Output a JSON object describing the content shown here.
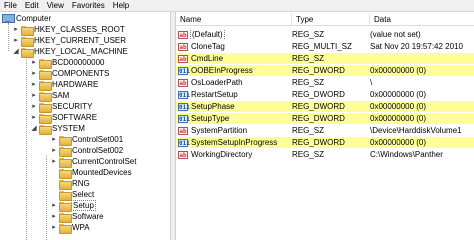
{
  "menu": [
    "File",
    "Edit",
    "View",
    "Favorites",
    "Help"
  ],
  "tree": {
    "root_label": "Computer",
    "items": [
      {
        "label": "HKEY_CLASSES_ROOT",
        "expander": "▸"
      },
      {
        "label": "HKEY_CURRENT_USER",
        "expander": "▸"
      },
      {
        "label": "HKEY_LOCAL_MACHINE",
        "expander": "◢"
      },
      {
        "label": "BCD00000000",
        "expander": "▸"
      },
      {
        "label": "COMPONENTS",
        "expander": "▸"
      },
      {
        "label": "HARDWARE",
        "expander": "▸"
      },
      {
        "label": "SAM",
        "expander": "▸"
      },
      {
        "label": "SECURITY",
        "expander": "▸"
      },
      {
        "label": "SOFTWARE",
        "expander": "▸"
      },
      {
        "label": "SYSTEM",
        "expander": "◢"
      },
      {
        "label": "ControlSet001",
        "expander": "▸"
      },
      {
        "label": "ControlSet002",
        "expander": "▸"
      },
      {
        "label": "CurrentControlSet",
        "expander": "▸"
      },
      {
        "label": "MountedDevices",
        "expander": ""
      },
      {
        "label": "RNG",
        "expander": ""
      },
      {
        "label": "Select",
        "expander": ""
      },
      {
        "label": "Setup",
        "expander": "▸"
      },
      {
        "label": "Software",
        "expander": "▸"
      },
      {
        "label": "WPA",
        "expander": "▸"
      }
    ]
  },
  "columns": {
    "name": "Name",
    "type": "Type",
    "data": "Data"
  },
  "values": [
    {
      "name": "(Default)",
      "type": "REG_SZ",
      "data": "(value not set)",
      "kind": "sz",
      "highlight": false
    },
    {
      "name": "CloneTag",
      "type": "REG_MULTI_SZ",
      "data": "Sat Nov 20 19:57:42 2010",
      "kind": "sz",
      "highlight": false
    },
    {
      "name": "CmdLine",
      "type": "REG_SZ",
      "data": "",
      "kind": "sz",
      "highlight": true
    },
    {
      "name": "OOBEInProgress",
      "type": "REG_DWORD",
      "data": "0x00000000 (0)",
      "kind": "dw",
      "highlight": true
    },
    {
      "name": "OsLoaderPath",
      "type": "REG_SZ",
      "data": "\\",
      "kind": "sz",
      "highlight": false
    },
    {
      "name": "RestartSetup",
      "type": "REG_DWORD",
      "data": "0x00000000 (0)",
      "kind": "dw",
      "highlight": false
    },
    {
      "name": "SetupPhase",
      "type": "REG_DWORD",
      "data": "0x00000000 (0)",
      "kind": "dw",
      "highlight": true
    },
    {
      "name": "SetupType",
      "type": "REG_DWORD",
      "data": "0x00000000 (0)",
      "kind": "dw",
      "highlight": true
    },
    {
      "name": "SystemPartition",
      "type": "REG_SZ",
      "data": "\\Device\\HarddiskVolume1",
      "kind": "sz",
      "highlight": false
    },
    {
      "name": "SystemSetupInProgress",
      "type": "REG_DWORD",
      "data": "0x00000000 (0)",
      "kind": "dw",
      "highlight": true
    },
    {
      "name": "WorkingDirectory",
      "type": "REG_SZ",
      "data": "C:\\Windows\\Panther",
      "kind": "sz",
      "highlight": false
    }
  ],
  "icons": {
    "sz": "ab",
    "dw": "011"
  },
  "colors": {
    "highlight": "#ffff99",
    "folder": "#e8bd4f"
  }
}
